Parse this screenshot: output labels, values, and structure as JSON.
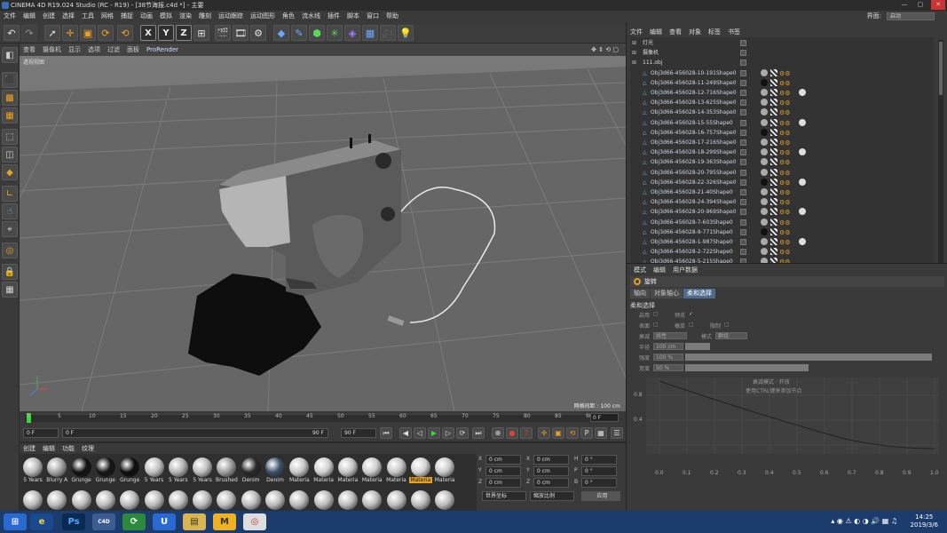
{
  "window": {
    "title": "CINEMA 4D R19.024 Studio (RC - R19) - [38节海报.c4d *] - 主要",
    "min": "—",
    "max": "▢",
    "close": "✕"
  },
  "menu": [
    "文件",
    "编辑",
    "创建",
    "选择",
    "工具",
    "网格",
    "捕捉",
    "动画",
    "模拟",
    "渲染",
    "雕刻",
    "运动跟踪",
    "运动图形",
    "角色",
    "流水线",
    "插件",
    "脚本",
    "窗口",
    "帮助"
  ],
  "layout": {
    "label": "界面:",
    "value": "启动"
  },
  "viewport": {
    "menu": [
      "查看",
      "摄像机",
      "显示",
      "选项",
      "过滤",
      "面板"
    ],
    "prorender": "ProRender",
    "label": "透视视图",
    "grid_label": "网格间距 : 100 cm"
  },
  "timeline": {
    "ticks": [
      "0",
      "5",
      "10",
      "15",
      "20",
      "25",
      "30",
      "35",
      "40",
      "45",
      "50",
      "55",
      "60",
      "65",
      "70",
      "75",
      "80",
      "85",
      "90"
    ],
    "frame": "0 F"
  },
  "transport": {
    "start": "0 F",
    "current": "0 F",
    "end": "90 F",
    "end2": "90 F"
  },
  "materials": {
    "tabs": [
      "创建",
      "编辑",
      "功能",
      "纹理"
    ],
    "items": [
      {
        "label": "5 Years",
        "color": "#b9b9b9",
        "selected": false
      },
      {
        "label": "Blurry A",
        "color": "#a5a5a5",
        "selected": false
      },
      {
        "label": "Grunge",
        "color": "#111111",
        "selected": false
      },
      {
        "label": "Grunge",
        "color": "#151515",
        "selected": false
      },
      {
        "label": "Grunge",
        "color": "#0d0d0d",
        "selected": false
      },
      {
        "label": "5 Years",
        "color": "#c0c0c0",
        "selected": false
      },
      {
        "label": "5 Years",
        "color": "#b5b5b5",
        "selected": false
      },
      {
        "label": "5 Years",
        "color": "#bdbdbd",
        "selected": false
      },
      {
        "label": "Brushed",
        "color": "#9e9e9e",
        "selected": false
      },
      {
        "label": "Denim",
        "color": "#2a2a2a",
        "selected": false
      },
      {
        "label": "Denim",
        "color": "#3a5068",
        "selected": false
      },
      {
        "label": "Materia",
        "color": "#c8c8c8",
        "selected": false
      },
      {
        "label": "Materia",
        "color": "#cfcfcf",
        "selected": false
      },
      {
        "label": "Materia",
        "color": "#c6c6c6",
        "selected": false
      },
      {
        "label": "Materia",
        "color": "#cccccc",
        "selected": false
      },
      {
        "label": "Materia",
        "color": "#c4c4c4",
        "selected": false
      },
      {
        "label": "Materia",
        "color": "#d2d2d2",
        "selected": true
      },
      {
        "label": "Materia",
        "color": "#c9c9c9",
        "selected": false
      }
    ]
  },
  "coords": {
    "rows": [
      {
        "a": "X",
        "av": "0 cm",
        "b": "X",
        "bv": "0 cm",
        "c": "H",
        "cv": "0 °"
      },
      {
        "a": "Y",
        "av": "0 cm",
        "b": "Y",
        "bv": "0 cm",
        "c": "P",
        "cv": "0 °"
      },
      {
        "a": "Z",
        "av": "0 cm",
        "b": "Z",
        "bv": "0 cm",
        "c": "B",
        "cv": "0 °"
      }
    ],
    "dropdown1": "世界坐标",
    "dropdown2": "缩放比例",
    "apply": "应用"
  },
  "right": {
    "tabs": [
      "文件",
      "编辑",
      "查看",
      "对象",
      "标签",
      "书签"
    ],
    "objects": [
      {
        "name": "灯光",
        "type": "group"
      },
      {
        "name": "摄像机",
        "type": "group"
      },
      {
        "name": "111.obj",
        "type": "group"
      },
      {
        "name": "Obj3d66-456028-10-191Shape0"
      },
      {
        "name": "Obj3d66-456028-11-249Shape0"
      },
      {
        "name": "Obj3d66-456028-12-716Shape0"
      },
      {
        "name": "Obj3d66-456028-13-625Shape0"
      },
      {
        "name": "Obj3d66-456028-14-353Shape0"
      },
      {
        "name": "Obj3d66-456028-15-55Shape0"
      },
      {
        "name": "Obj3d66-456028-16-757Shape0"
      },
      {
        "name": "Obj3d66-456028-17-216Shape0"
      },
      {
        "name": "Obj3d66-456028-18-299Shape0"
      },
      {
        "name": "Obj3d66-456028-19-363Shape0"
      },
      {
        "name": "Obj3d66-456028-20-795Shape0"
      },
      {
        "name": "Obj3d66-456028-22-326Shape0"
      },
      {
        "name": "Obj3d66-456028-21-40Shape0"
      },
      {
        "name": "Obj3d66-456028-24-394Shape0"
      },
      {
        "name": "Obj3d66-456028-20-969Shape0"
      },
      {
        "name": "Obj3d66-456028-7-603Shape0"
      },
      {
        "name": "Obj3d66-456028-9-771Shape0"
      },
      {
        "name": "Obj3d66-456028-1-987Shape0"
      },
      {
        "name": "Obj3d66-456028-2-722Shape0"
      },
      {
        "name": "Obj3d66-456028-5-215Shape0"
      }
    ],
    "attr_tabs": [
      "模式",
      "编辑",
      "用户数据"
    ],
    "attr_title": "旋转",
    "attr_subtabs": [
      "轴向",
      "对象轴心",
      "柔和选择"
    ],
    "section": "柔和选择",
    "labels": {
      "enable": "启用",
      "preview": "预览",
      "surface": "表面",
      "rubber": "橡皮",
      "restrict": "限制",
      "mode": "衰减",
      "mode_val": "线性",
      "mode2": "模式",
      "mode2_val": "群组",
      "radius": "半径",
      "radius_val": "100 cm",
      "strength": "强度",
      "strength_val": "100 %",
      "width": "宽度",
      "width_val": "50 %",
      "graph_hint1": "衰减模式 · 开放",
      "graph_hint2": "使用CTRL键来添加节点"
    },
    "graph_y": [
      "0.8",
      "0.4"
    ],
    "graph_x": [
      "0.0",
      "0.1",
      "0.2",
      "0.3",
      "0.4",
      "0.5",
      "0.6",
      "0.7",
      "0.8",
      "0.9",
      "1.0"
    ]
  },
  "taskbar": {
    "items": [
      "⊞",
      "e",
      "Ps",
      "C4D",
      "⟳",
      "U",
      "▤",
      "M",
      "◎"
    ],
    "time": "14:25",
    "date": "2019/3/6"
  }
}
